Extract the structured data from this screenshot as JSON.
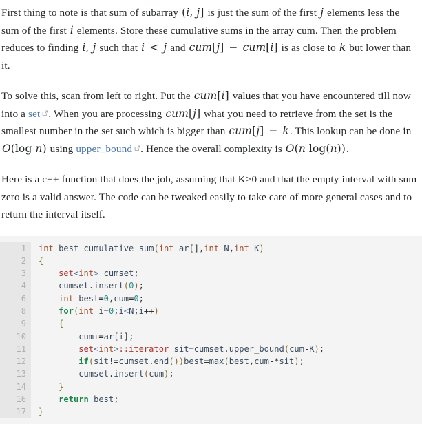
{
  "page": {
    "background": "#ffffff",
    "text_color": "#242729",
    "link_color": "#4a74a8"
  },
  "paragraphs": [
    {
      "id": "p1",
      "segments": [
        {
          "type": "text",
          "value": "First thing to note is that sum of subarray "
        },
        {
          "type": "math",
          "value": "(i, j]"
        },
        {
          "type": "text",
          "value": " is just the sum of the first "
        },
        {
          "type": "math",
          "value": "j"
        },
        {
          "type": "text",
          "value": " elements less the sum of the first "
        },
        {
          "type": "math",
          "value": "i"
        },
        {
          "type": "text",
          "value": " elements. Store these cumulative sums in the array cum. Then the problem reduces to finding "
        },
        {
          "type": "math",
          "value": "i, j"
        },
        {
          "type": "text",
          "value": " such that "
        },
        {
          "type": "math",
          "value": "i < j"
        },
        {
          "type": "text",
          "value": " and "
        },
        {
          "type": "math",
          "value": "cum[j] − cum[i]"
        },
        {
          "type": "text",
          "value": " is as close to "
        },
        {
          "type": "math",
          "value": "k"
        },
        {
          "type": "text",
          "value": " but lower than it."
        }
      ]
    },
    {
      "id": "p2",
      "segments": [
        {
          "type": "text",
          "value": "To solve this, scan from left to right. Put the "
        },
        {
          "type": "math",
          "value": "cum[i]"
        },
        {
          "type": "text",
          "value": " values that you have encountered till now into a "
        },
        {
          "type": "link",
          "value": "set",
          "icon": "external-link-icon"
        },
        {
          "type": "text",
          "value": ". When you are processing "
        },
        {
          "type": "math",
          "value": "cum[j]"
        },
        {
          "type": "text",
          "value": " what you need to retrieve from the set is the smallest number in the set such which is bigger than "
        },
        {
          "type": "math",
          "value": "cum[j] − k"
        },
        {
          "type": "text",
          "value": ". This lookup can be done in "
        },
        {
          "type": "math",
          "value": "O(log n)"
        },
        {
          "type": "text",
          "value": " using "
        },
        {
          "type": "link",
          "value": "upper_bound",
          "icon": "external-link-icon"
        },
        {
          "type": "text",
          "value": ". Hence the overall complexity is "
        },
        {
          "type": "math",
          "value": "O(n log(n))"
        },
        {
          "type": "text",
          "value": "."
        }
      ]
    },
    {
      "id": "p3",
      "segments": [
        {
          "type": "text",
          "value": "Here is a c++ function that does the job, assuming that K>0 and that the empty interval with sum zero is a valid answer. The code can be tweaked easily to take care of more general cases and to return the interval itself."
        }
      ]
    }
  ],
  "code_block": {
    "language": "cpp",
    "background": "#f4f4f4",
    "gutter_background": "#e7e7e7",
    "gutter_color": "#afafaf",
    "lines": [
      {
        "number": "1",
        "text": "int best_cumulative_sum(int ar[],int N,int K)"
      },
      {
        "number": "2",
        "text": "{"
      },
      {
        "number": "3",
        "text": "    set<int> cumset;"
      },
      {
        "number": "4",
        "text": "    cumset.insert(0);"
      },
      {
        "number": "6",
        "text": "    int best=0,cum=0;"
      },
      {
        "number": "8",
        "text": "    for(int i=0;i<N;i++)"
      },
      {
        "number": "9",
        "text": "    {"
      },
      {
        "number": "10",
        "text": "        cum+=ar[i];"
      },
      {
        "number": "11",
        "text": "        set<int>::iterator sit=cumset.upper_bound(cum-K);"
      },
      {
        "number": "12",
        "text": "        if(sit!=cumset.end())best=max(best,cum-*sit);"
      },
      {
        "number": "13",
        "text": "        cumset.insert(cum);"
      },
      {
        "number": "14",
        "text": "    }"
      },
      {
        "number": "16",
        "text": "    return best;"
      },
      {
        "number": "17",
        "text": "}"
      }
    ]
  }
}
